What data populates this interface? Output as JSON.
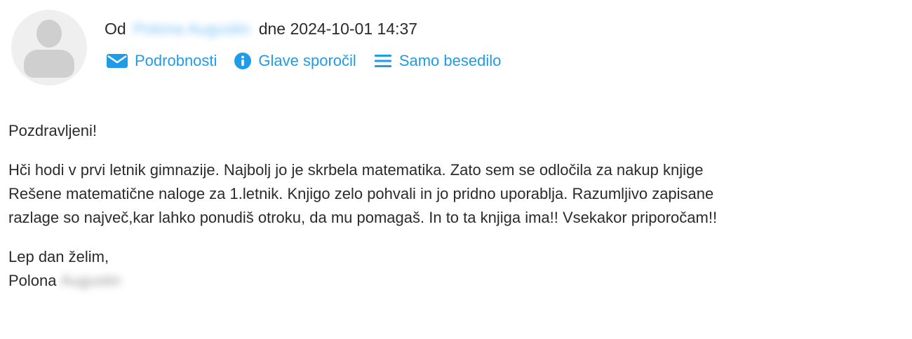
{
  "header": {
    "from_prefix": "Od",
    "sender_name": "Polona Augustin",
    "date_text": "dne 2024-10-01 14:37",
    "actions": [
      {
        "label": "Podrobnosti",
        "icon": "envelope-icon"
      },
      {
        "label": "Glave sporočil",
        "icon": "info-icon"
      },
      {
        "label": "Samo besedilo",
        "icon": "menu-lines-icon"
      }
    ]
  },
  "message": {
    "greeting": "Pozdravljeni!",
    "paragraph_lines": [
      "Hči hodi v prvi letnik gimnazije. Najbolj jo je skrbela matematika. Zato sem se odločila za nakup knjige",
      "Rešene matematične naloge za 1.letnik. Knjigo zelo pohvali in jo pridno uporablja. Razumljivo zapisane",
      "razlage so največ,kar lahko ponudiš otroku, da mu  pomagaš. In to ta knjiga ima!! Vsekakor priporočam!!"
    ],
    "closing": "Lep dan želim,",
    "signature_first": "Polona",
    "signature_last": "Augustin"
  },
  "colors": {
    "accent": "#1f9be8",
    "text": "#2b2b2b",
    "avatar_bg": "#efefef",
    "avatar_fg": "#cfcfcf"
  }
}
